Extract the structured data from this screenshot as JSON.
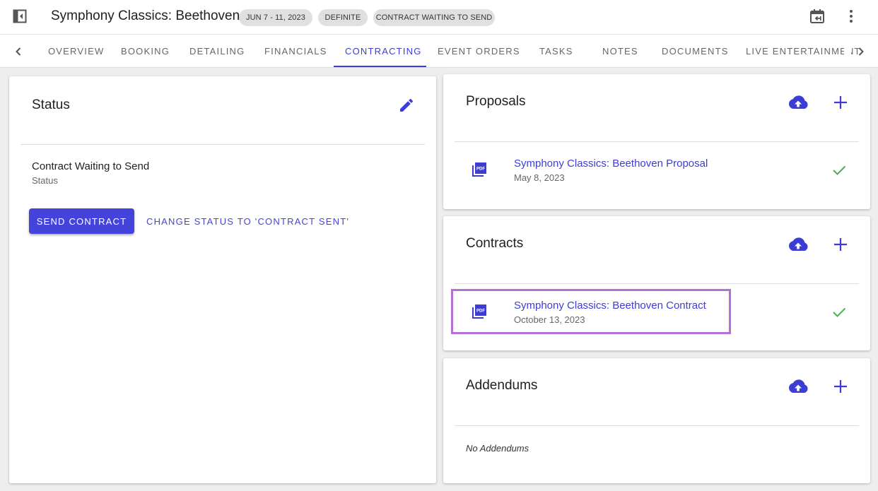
{
  "header": {
    "title": "Symphony Classics: Beethoven",
    "chips": {
      "date": "JUN 7 - 11, 2023",
      "booking_status": "DEFINITE",
      "contract_status": "CONTRACT WAITING TO SEND"
    },
    "icons": [
      "sidebar-collapse-icon",
      "calendar-back-icon",
      "more-vert-icon"
    ]
  },
  "tabs": {
    "items": [
      {
        "label": "OVERVIEW"
      },
      {
        "label": "BOOKING"
      },
      {
        "label": "DETAILING"
      },
      {
        "label": "FINANCIALS"
      },
      {
        "label": "CONTRACTING",
        "active": true
      },
      {
        "label": "EVENT ORDERS"
      },
      {
        "label": "TASKS"
      },
      {
        "label": "NOTES"
      },
      {
        "label": "DOCUMENTS"
      },
      {
        "label": "LIVE ENTERTAINMENT"
      }
    ]
  },
  "status_card": {
    "title": "Status",
    "value": "Contract Waiting to Send",
    "caption": "Status",
    "send_label": "SEND CONTRACT",
    "change_label": "CHANGE STATUS TO 'CONTRACT SENT'"
  },
  "proposals": {
    "title": "Proposals",
    "items": [
      {
        "name": "Symphony Classics: Beethoven Proposal",
        "date": "May 8, 2023"
      }
    ]
  },
  "contracts": {
    "title": "Contracts",
    "items": [
      {
        "name": "Symphony Classics: Beethoven Contract",
        "date": "October 13, 2023"
      }
    ]
  },
  "addendums": {
    "title": "Addendums",
    "empty_text": "No Addendums"
  },
  "colors": {
    "accent": "#3d3dd6",
    "button": "#4444dc",
    "check": "#4caf50",
    "highlight": "#b36fd8"
  }
}
